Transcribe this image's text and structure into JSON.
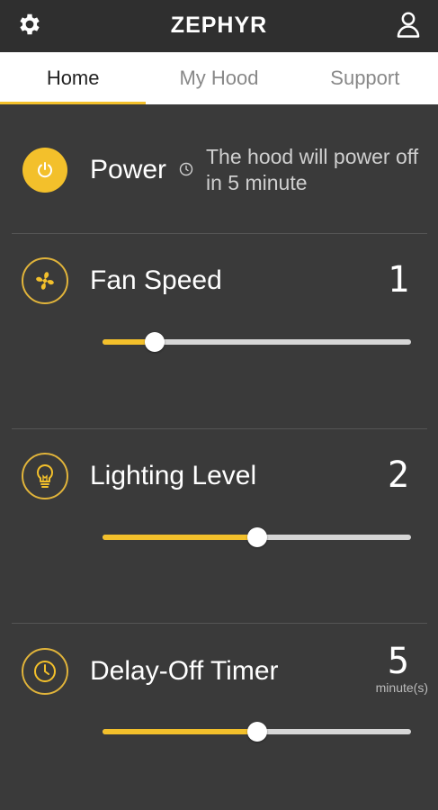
{
  "header": {
    "brand": "ZEPHYR",
    "settings_icon": "gear-icon",
    "account_icon": "user-icon"
  },
  "tabs": [
    {
      "label": "Home",
      "active": true
    },
    {
      "label": "My Hood",
      "active": false
    },
    {
      "label": "Support",
      "active": false
    }
  ],
  "power": {
    "label": "Power",
    "note": "The hood will power off in 5 minute",
    "on": true
  },
  "fan": {
    "label": "Fan Speed",
    "value": "1",
    "level": 0.17
  },
  "lighting": {
    "label": "Lighting Level",
    "value": "2",
    "level": 0.5
  },
  "timer": {
    "label": "Delay-Off Timer",
    "value": "5",
    "unit": "minute(s)",
    "level": 0.5
  },
  "colors": {
    "accent": "#f3c02b",
    "background": "#3a3a3a",
    "header": "#2f2f2f"
  }
}
